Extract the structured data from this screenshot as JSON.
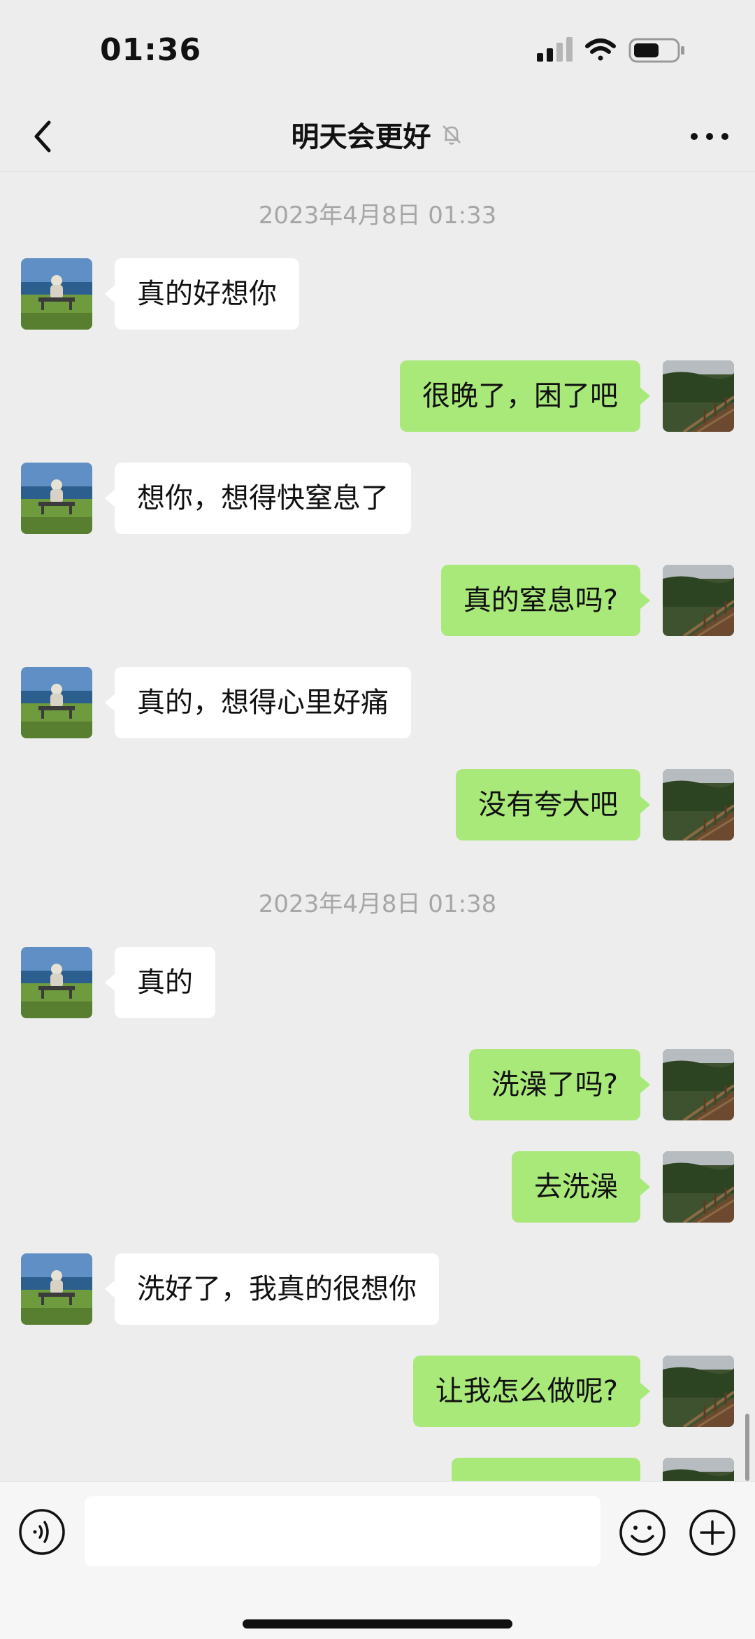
{
  "status_bar": {
    "time": "01:36",
    "battery_level": 0.6
  },
  "header": {
    "title": "明天会更好",
    "muted": true
  },
  "messages": {
    "ts1": "2023年4月8日 01:33",
    "m1": "真的好想你",
    "m2": "很晚了，困了吧",
    "m3": "想你，想得快窒息了",
    "m4": "真的窒息吗?",
    "m5": "真的，想得心里好痛",
    "m6": "没有夸大吧",
    "ts2": "2023年4月8日 01:38",
    "m7": "真的",
    "m8": "洗澡了吗?",
    "m9": "去洗澡",
    "m10": "洗好了，我真的很想你",
    "m11": "让我怎么做呢?"
  },
  "input": {
    "value": "",
    "placeholder": ""
  },
  "icons": {
    "back": "chevron-left-icon",
    "mute": "bell-slash-icon",
    "more": "ellipsis-icon",
    "voice": "voice-icon",
    "emoji": "smiley-icon",
    "plus": "plus-circle-icon"
  },
  "colors": {
    "outgoing_bubble": "#a9e97a",
    "incoming_bubble": "#ffffff",
    "background": "#ededed"
  }
}
